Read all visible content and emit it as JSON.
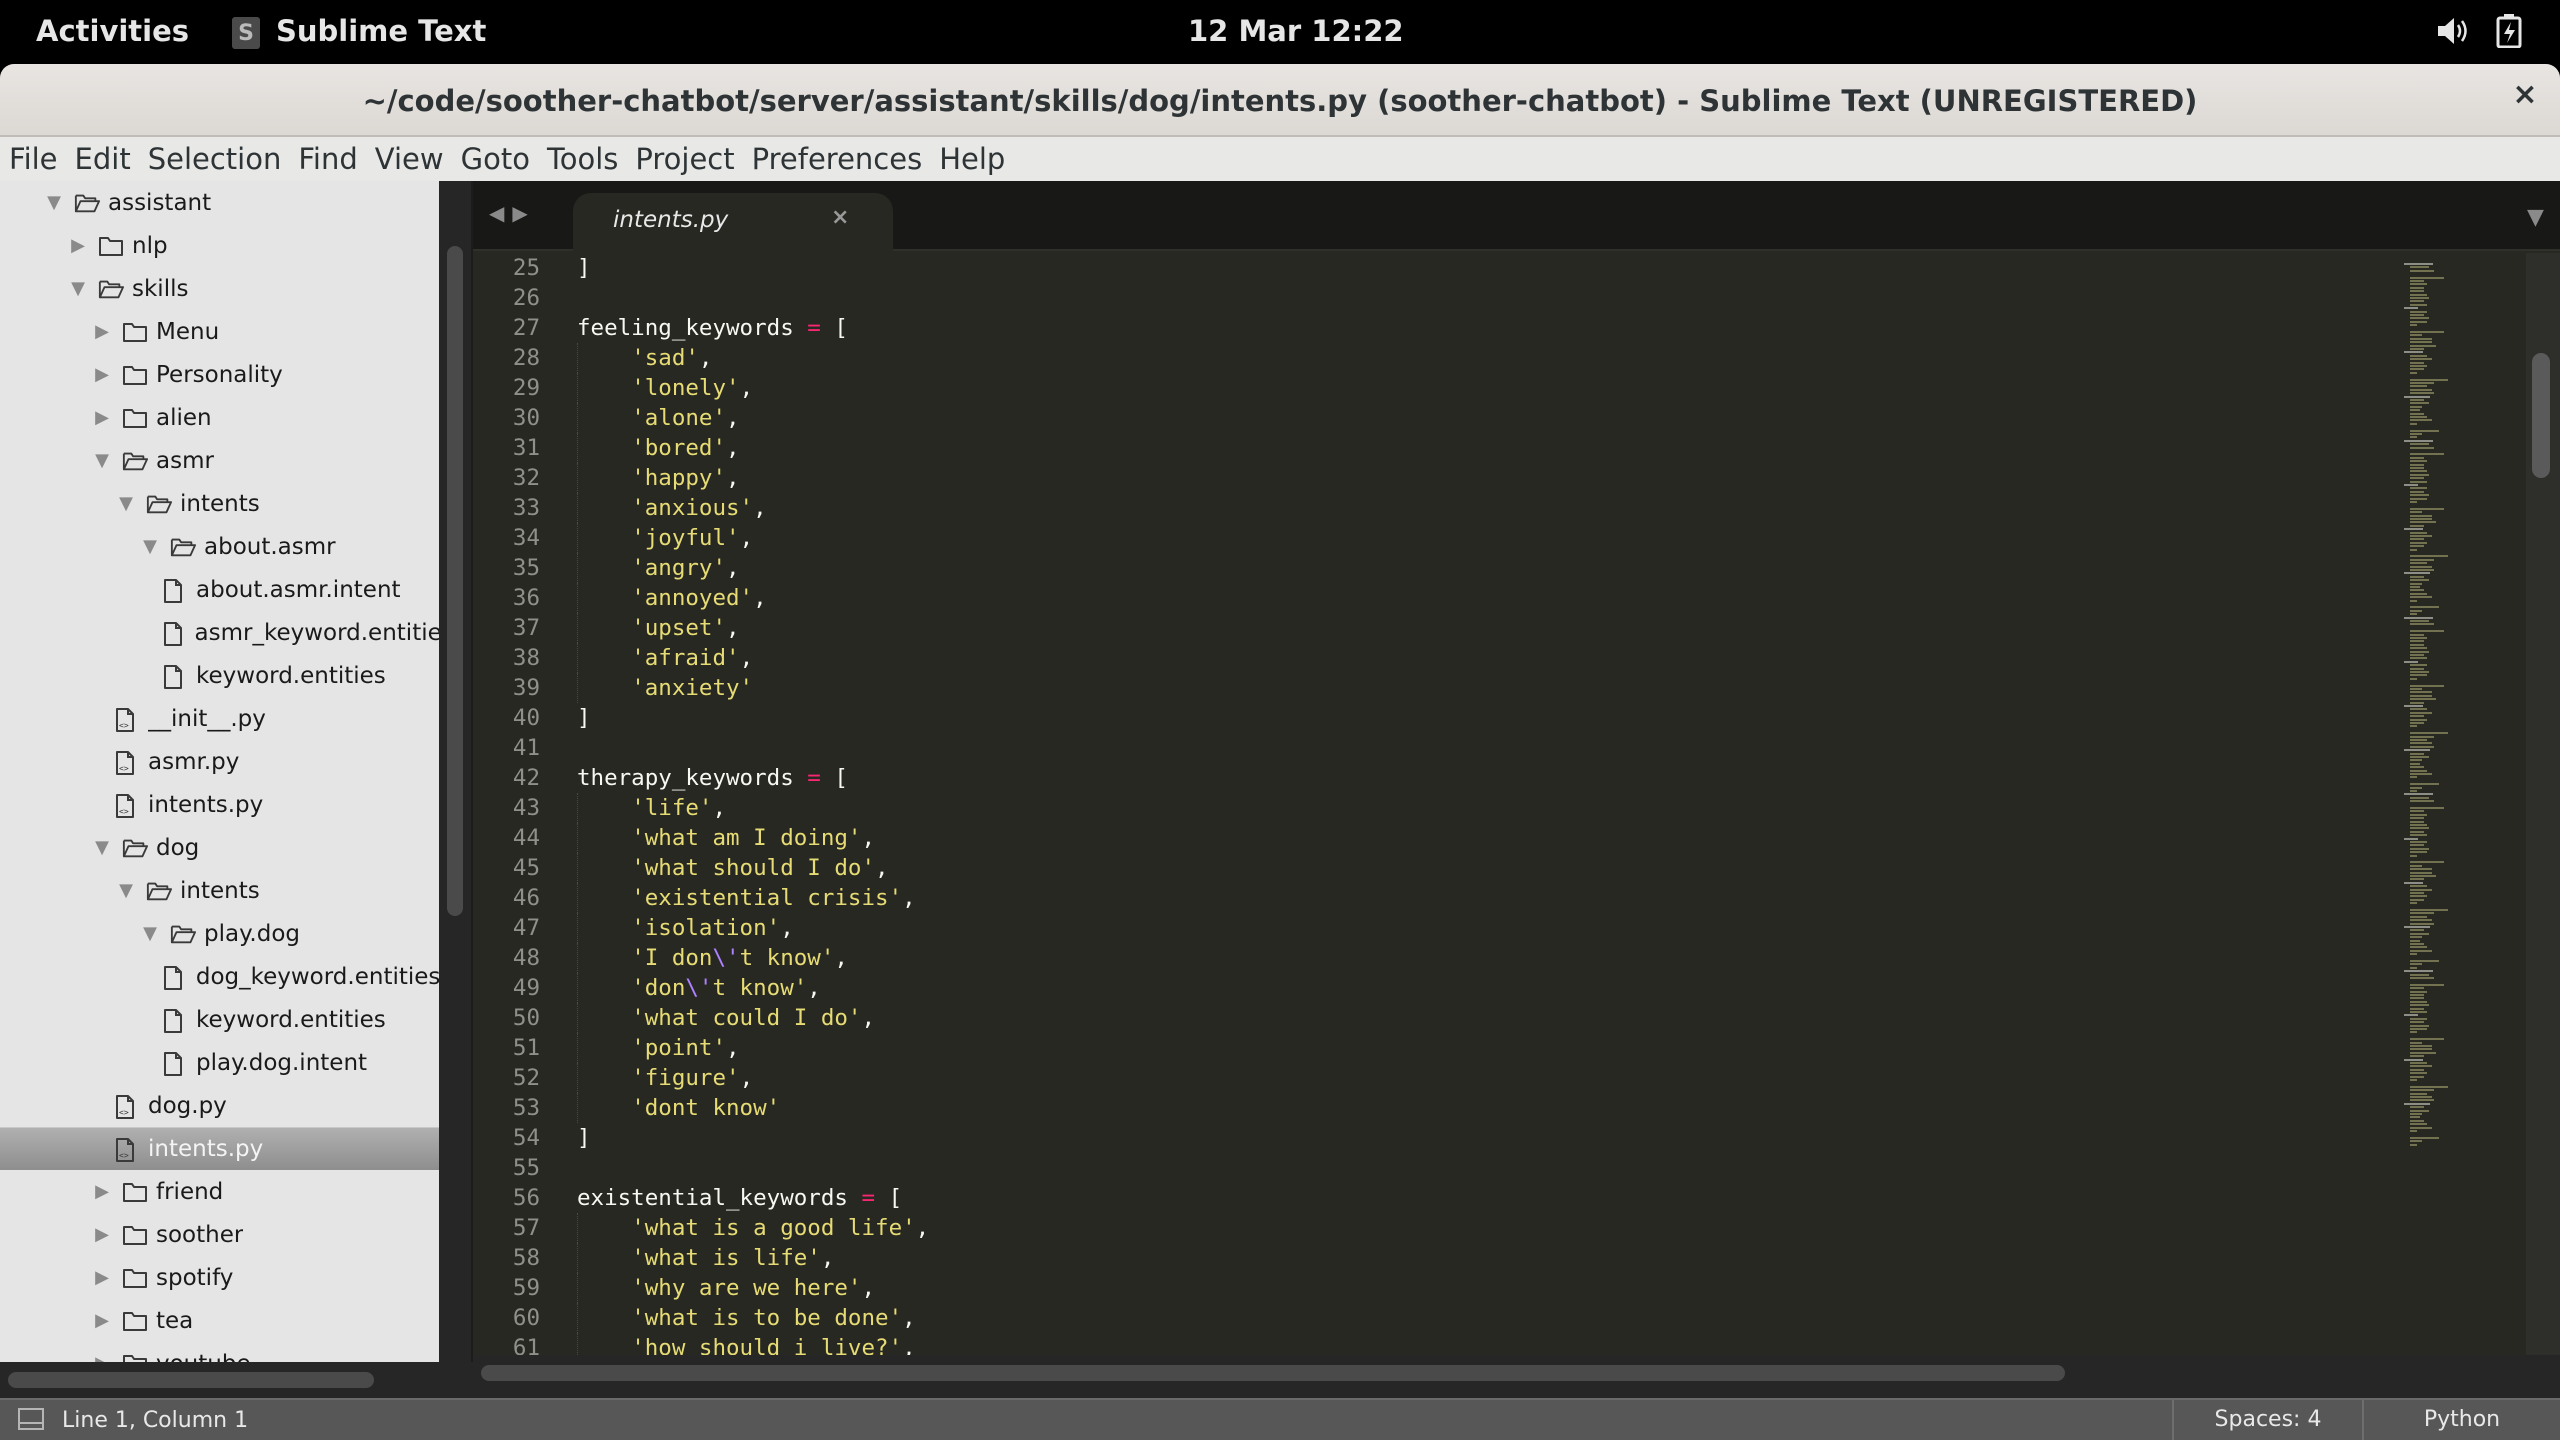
{
  "topbar": {
    "activities": "Activities",
    "app_name": "Sublime Text",
    "app_icon": "sublime-text-icon",
    "clock": "12 Mar  12:22",
    "status_icons": [
      "volume-icon",
      "battery-charging-icon"
    ]
  },
  "window": {
    "title": "~/code/soother-chatbot/server/assistant/skills/dog/intents.py (soother-chatbot) - Sublime Text (UNREGISTERED)",
    "close_label": "×"
  },
  "menu": [
    "File",
    "Edit",
    "Selection",
    "Find",
    "View",
    "Goto",
    "Tools",
    "Project",
    "Preferences",
    "Help"
  ],
  "sidebar": {
    "tree": [
      {
        "label": "assistant",
        "type": "folder",
        "open": true,
        "depth": 0
      },
      {
        "label": "nlp",
        "type": "folder",
        "open": false,
        "depth": 1
      },
      {
        "label": "skills",
        "type": "folder",
        "open": true,
        "depth": 1
      },
      {
        "label": "Menu",
        "type": "folder",
        "open": false,
        "depth": 2
      },
      {
        "label": "Personality",
        "type": "folder",
        "open": false,
        "depth": 2
      },
      {
        "label": "alien",
        "type": "folder",
        "open": false,
        "depth": 2
      },
      {
        "label": "asmr",
        "type": "folder",
        "open": true,
        "depth": 2
      },
      {
        "label": "intents",
        "type": "folder",
        "open": true,
        "depth": 3
      },
      {
        "label": "about.asmr",
        "type": "folder",
        "open": true,
        "depth": 4
      },
      {
        "label": "about.asmr.intent",
        "type": "file",
        "depth": 5
      },
      {
        "label": "asmr_keyword.entities",
        "type": "file",
        "depth": 5
      },
      {
        "label": "keyword.entities",
        "type": "file",
        "depth": 5
      },
      {
        "label": "__init__.py",
        "type": "pyfile",
        "depth": 3
      },
      {
        "label": "asmr.py",
        "type": "pyfile",
        "depth": 3
      },
      {
        "label": "intents.py",
        "type": "pyfile",
        "depth": 3
      },
      {
        "label": "dog",
        "type": "folder",
        "open": true,
        "depth": 2
      },
      {
        "label": "intents",
        "type": "folder",
        "open": true,
        "depth": 3
      },
      {
        "label": "play.dog",
        "type": "folder",
        "open": true,
        "depth": 4
      },
      {
        "label": "dog_keyword.entities",
        "type": "file",
        "depth": 5
      },
      {
        "label": "keyword.entities",
        "type": "file",
        "depth": 5
      },
      {
        "label": "play.dog.intent",
        "type": "file",
        "depth": 5
      },
      {
        "label": "dog.py",
        "type": "pyfile",
        "depth": 3
      },
      {
        "label": "intents.py",
        "type": "pyfile",
        "depth": 3,
        "selected": true
      },
      {
        "label": "friend",
        "type": "folder",
        "open": false,
        "depth": 2
      },
      {
        "label": "soother",
        "type": "folder",
        "open": false,
        "depth": 2
      },
      {
        "label": "spotify",
        "type": "folder",
        "open": false,
        "depth": 2
      },
      {
        "label": "tea",
        "type": "folder",
        "open": false,
        "depth": 2
      },
      {
        "label": "youtube",
        "type": "folder",
        "open": false,
        "depth": 2
      }
    ]
  },
  "editor": {
    "tab": {
      "label": "intents.py",
      "close_label": "×"
    },
    "nav_back": "◀",
    "nav_forward": "▶",
    "tab_menu": "▼",
    "lines": [
      {
        "n": "25",
        "tokens": [
          [
            "p",
            "]"
          ]
        ]
      },
      {
        "n": "26",
        "tokens": []
      },
      {
        "n": "27",
        "tokens": [
          [
            "p",
            "feeling_keywords "
          ],
          [
            "o",
            "="
          ],
          [
            "p",
            " ["
          ]
        ]
      },
      {
        "n": "28",
        "indent": true,
        "tokens": [
          [
            "s",
            "'sad'"
          ],
          [
            "p",
            ","
          ]
        ]
      },
      {
        "n": "29",
        "indent": true,
        "tokens": [
          [
            "s",
            "'lonely'"
          ],
          [
            "p",
            ","
          ]
        ]
      },
      {
        "n": "30",
        "indent": true,
        "tokens": [
          [
            "s",
            "'alone'"
          ],
          [
            "p",
            ","
          ]
        ]
      },
      {
        "n": "31",
        "indent": true,
        "tokens": [
          [
            "s",
            "'bored'"
          ],
          [
            "p",
            ","
          ]
        ]
      },
      {
        "n": "32",
        "indent": true,
        "tokens": [
          [
            "s",
            "'happy'"
          ],
          [
            "p",
            ","
          ]
        ]
      },
      {
        "n": "33",
        "indent": true,
        "tokens": [
          [
            "s",
            "'anxious'"
          ],
          [
            "p",
            ","
          ]
        ]
      },
      {
        "n": "34",
        "indent": true,
        "tokens": [
          [
            "s",
            "'joyful'"
          ],
          [
            "p",
            ","
          ]
        ]
      },
      {
        "n": "35",
        "indent": true,
        "tokens": [
          [
            "s",
            "'angry'"
          ],
          [
            "p",
            ","
          ]
        ]
      },
      {
        "n": "36",
        "indent": true,
        "tokens": [
          [
            "s",
            "'annoyed'"
          ],
          [
            "p",
            ","
          ]
        ]
      },
      {
        "n": "37",
        "indent": true,
        "tokens": [
          [
            "s",
            "'upset'"
          ],
          [
            "p",
            ","
          ]
        ]
      },
      {
        "n": "38",
        "indent": true,
        "tokens": [
          [
            "s",
            "'afraid'"
          ],
          [
            "p",
            ","
          ]
        ]
      },
      {
        "n": "39",
        "indent": true,
        "tokens": [
          [
            "s",
            "'anxiety'"
          ]
        ]
      },
      {
        "n": "40",
        "tokens": [
          [
            "p",
            "]"
          ]
        ]
      },
      {
        "n": "41",
        "tokens": []
      },
      {
        "n": "42",
        "tokens": [
          [
            "p",
            "therapy_keywords "
          ],
          [
            "o",
            "="
          ],
          [
            "p",
            " ["
          ]
        ]
      },
      {
        "n": "43",
        "indent": true,
        "tokens": [
          [
            "s",
            "'life'"
          ],
          [
            "p",
            ","
          ]
        ]
      },
      {
        "n": "44",
        "indent": true,
        "tokens": [
          [
            "s",
            "'what am I doing'"
          ],
          [
            "p",
            ","
          ]
        ]
      },
      {
        "n": "45",
        "indent": true,
        "tokens": [
          [
            "s",
            "'what should I do'"
          ],
          [
            "p",
            ","
          ]
        ]
      },
      {
        "n": "46",
        "indent": true,
        "tokens": [
          [
            "s",
            "'existential crisis'"
          ],
          [
            "p",
            ","
          ]
        ]
      },
      {
        "n": "47",
        "indent": true,
        "tokens": [
          [
            "s",
            "'isolation'"
          ],
          [
            "p",
            ","
          ]
        ]
      },
      {
        "n": "48",
        "indent": true,
        "tokens": [
          [
            "s",
            "'I don"
          ],
          [
            "e",
            "\\'"
          ],
          [
            "s",
            "t know'"
          ],
          [
            "p",
            ","
          ]
        ]
      },
      {
        "n": "49",
        "indent": true,
        "tokens": [
          [
            "s",
            "'don"
          ],
          [
            "e",
            "\\'"
          ],
          [
            "s",
            "t know'"
          ],
          [
            "p",
            ","
          ]
        ]
      },
      {
        "n": "50",
        "indent": true,
        "tokens": [
          [
            "s",
            "'what could I do'"
          ],
          [
            "p",
            ","
          ]
        ]
      },
      {
        "n": "51",
        "indent": true,
        "tokens": [
          [
            "s",
            "'point'"
          ],
          [
            "p",
            ","
          ]
        ]
      },
      {
        "n": "52",
        "indent": true,
        "tokens": [
          [
            "s",
            "'figure'"
          ],
          [
            "p",
            ","
          ]
        ]
      },
      {
        "n": "53",
        "indent": true,
        "tokens": [
          [
            "s",
            "'dont know'"
          ]
        ]
      },
      {
        "n": "54",
        "tokens": [
          [
            "p",
            "]"
          ]
        ]
      },
      {
        "n": "55",
        "tokens": []
      },
      {
        "n": "56",
        "tokens": [
          [
            "p",
            "existential_keywords "
          ],
          [
            "o",
            "="
          ],
          [
            "p",
            " ["
          ]
        ]
      },
      {
        "n": "57",
        "indent": true,
        "tokens": [
          [
            "s",
            "'what is a good life'"
          ],
          [
            "p",
            ","
          ]
        ]
      },
      {
        "n": "58",
        "indent": true,
        "tokens": [
          [
            "s",
            "'what is life'"
          ],
          [
            "p",
            ","
          ]
        ]
      },
      {
        "n": "59",
        "indent": true,
        "tokens": [
          [
            "s",
            "'why are we here'"
          ],
          [
            "p",
            ","
          ]
        ]
      },
      {
        "n": "60",
        "indent": true,
        "tokens": [
          [
            "s",
            "'what is to be done'"
          ],
          [
            "p",
            ","
          ]
        ]
      },
      {
        "n": "61",
        "indent": true,
        "tokens": [
          [
            "s",
            "'how should i live?'"
          ],
          [
            "p",
            ","
          ]
        ]
      }
    ]
  },
  "statusbar": {
    "panel_icon": "panel-toggle-icon",
    "position": "Line 1, Column 1",
    "indentation": "Spaces: 4",
    "syntax": "Python"
  },
  "colors": {
    "editor_bg": "#272822",
    "string": "#e6db74",
    "operator": "#f92672",
    "escape": "#ae81ff",
    "plain": "#f8f8f2",
    "line_number": "#8f908a",
    "sidebar_bg": "#e5e5e5",
    "selected_row": "#9a9a9a"
  }
}
